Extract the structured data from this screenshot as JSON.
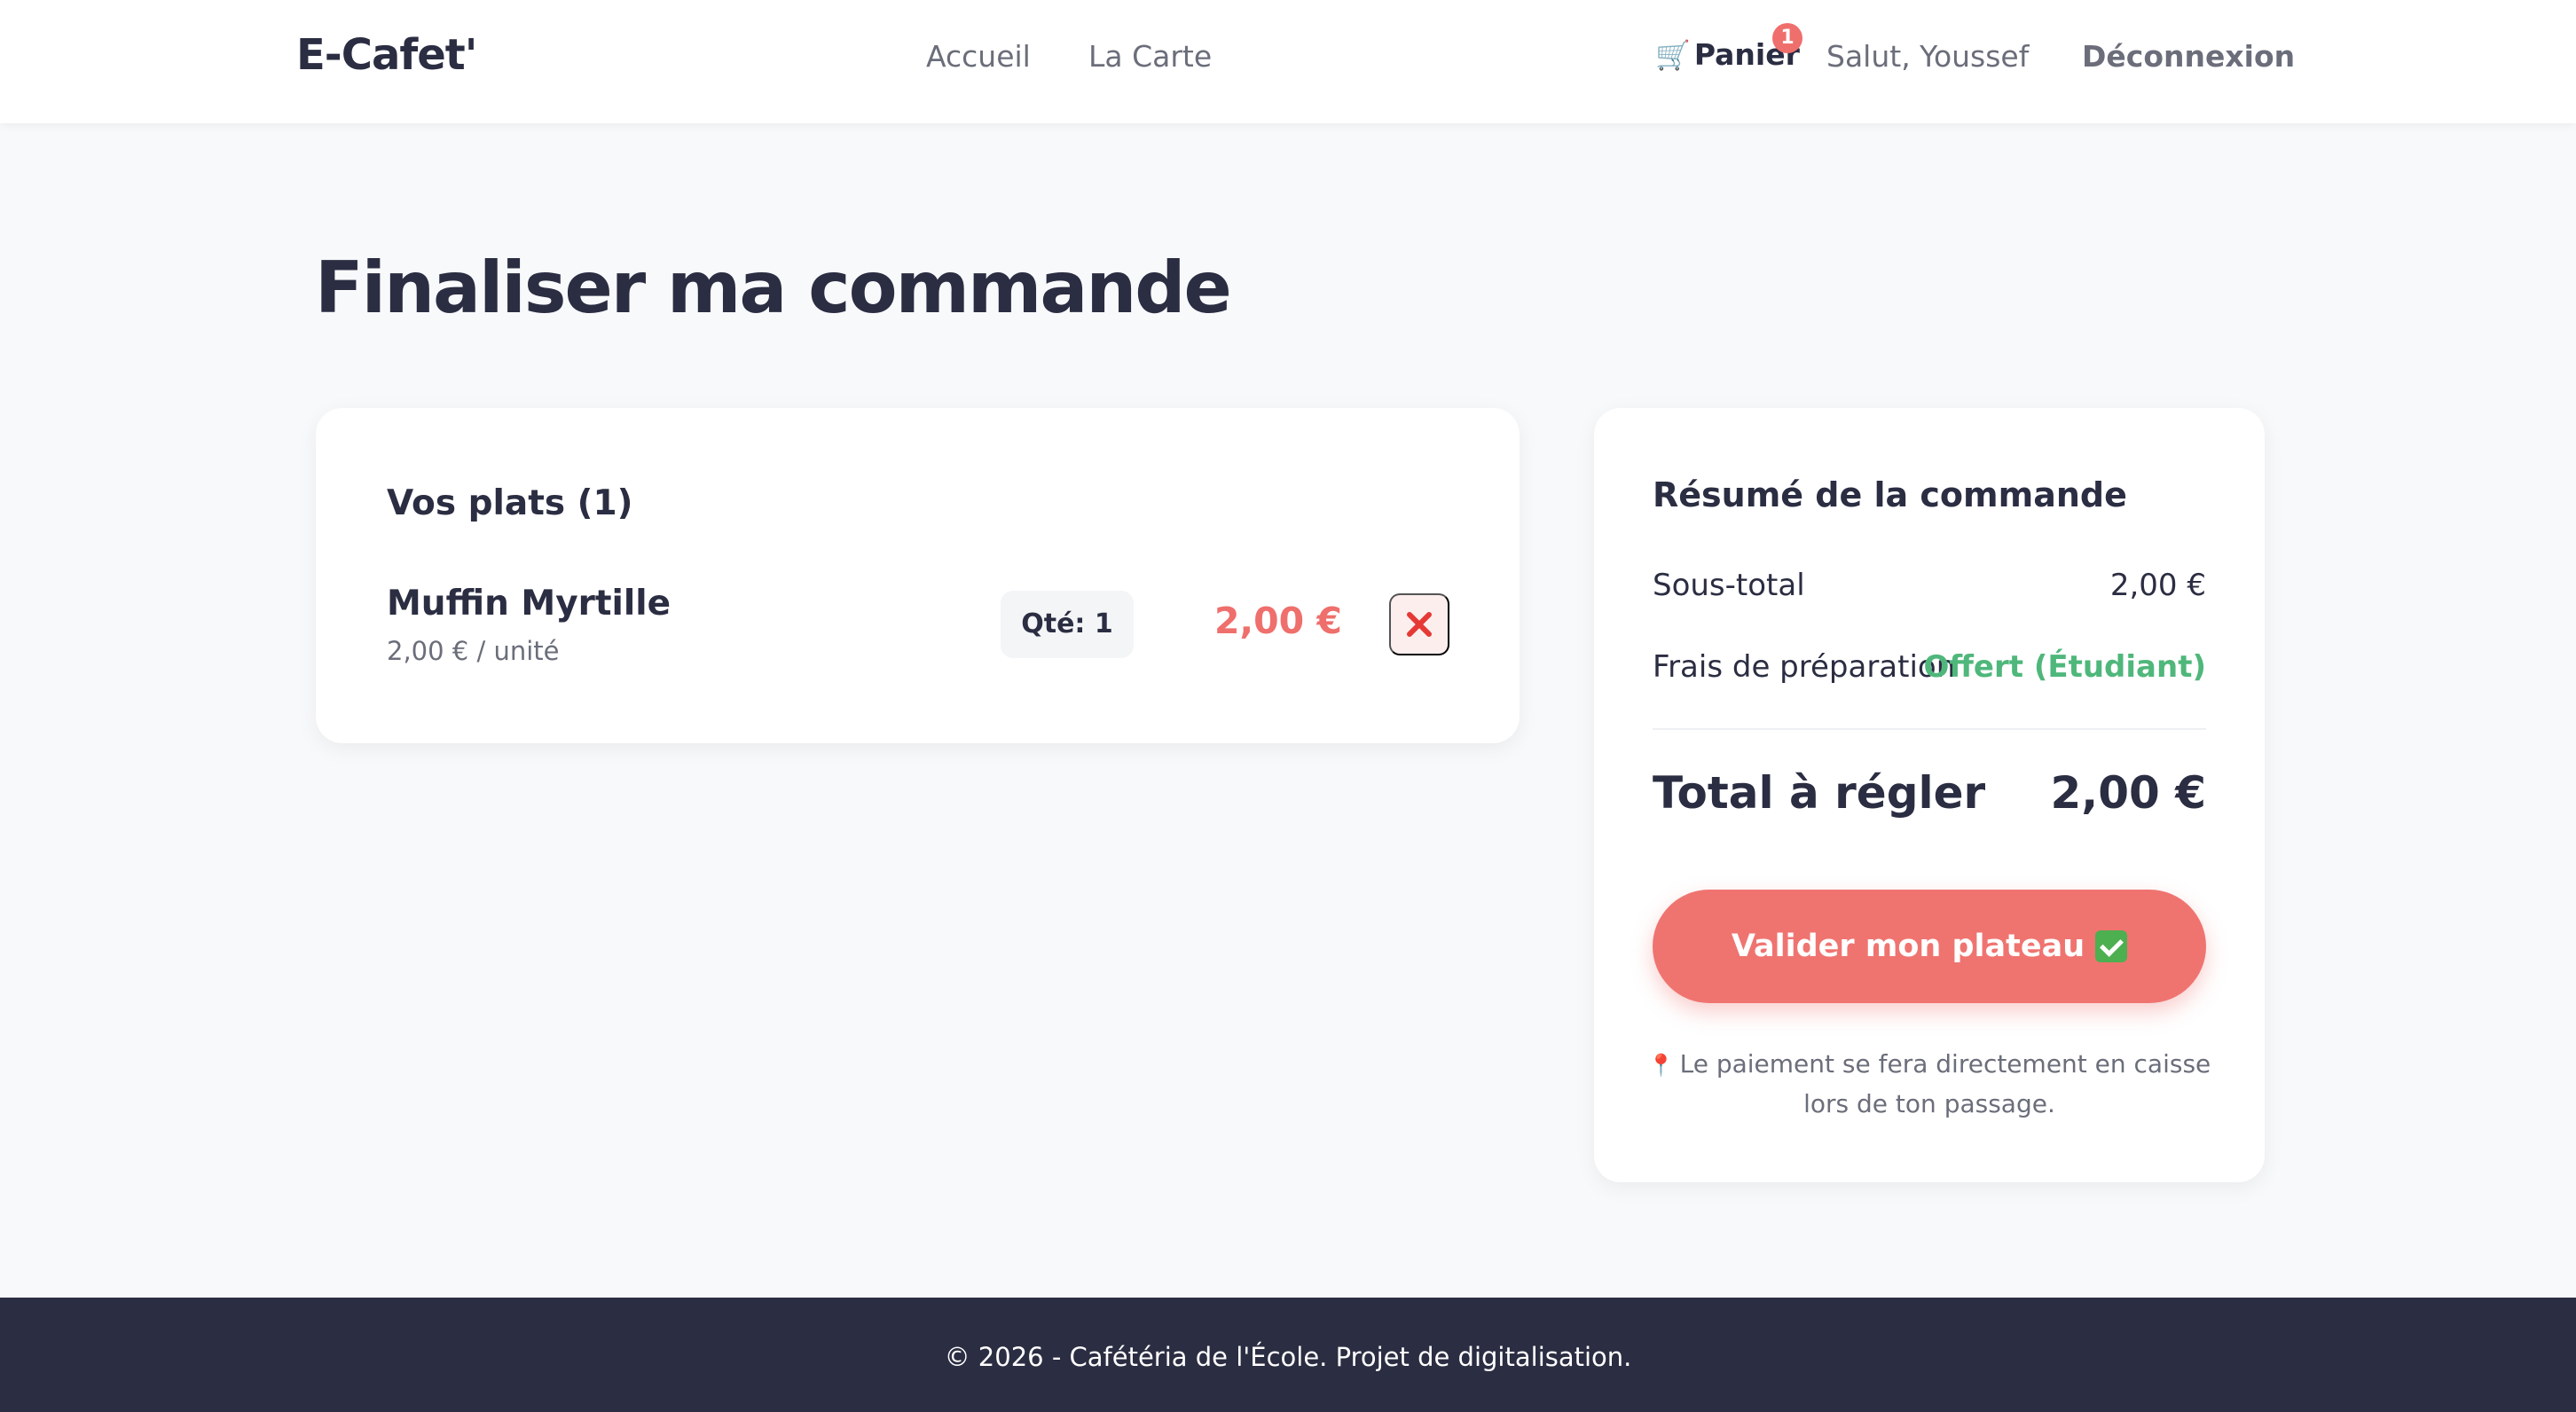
{
  "header": {
    "logo": "E-Cafet'",
    "nav": {
      "home": "Accueil",
      "menu": "La Carte"
    },
    "cart": {
      "label": "Panier",
      "count": "1",
      "icon": "cart-icon"
    },
    "greeting": "Salut, Youssef",
    "logout": "Déconnexion"
  },
  "page": {
    "title": "Finaliser ma commande"
  },
  "items": {
    "title": "Vos plats (1)",
    "list": [
      {
        "name": "Muffin Myrtille",
        "unit_price": "2,00 € / unité",
        "qty": "Qté: 1",
        "price": "2,00 €"
      }
    ]
  },
  "summary": {
    "title": "Résumé de la commande",
    "subtotal_label": "Sous-total",
    "subtotal_value": "2,00 €",
    "fee_label": "Frais de préparation",
    "fee_value": "Offert (Étudiant)",
    "total_label": "Total à régler",
    "total_value": "2,00 €",
    "validate_label": "Valider mon plateau",
    "payment_note": "Le paiement se fera directement en caisse lors de ton passage."
  },
  "footer": {
    "text": "© 2026 - Cafétéria de l'École. Projet de digitalisation."
  },
  "colors": {
    "accent": "#ef7470",
    "price": "#ef6f6c",
    "success": "#4fb77b",
    "dark": "#2b2d42",
    "muted": "#6b6e7a"
  }
}
